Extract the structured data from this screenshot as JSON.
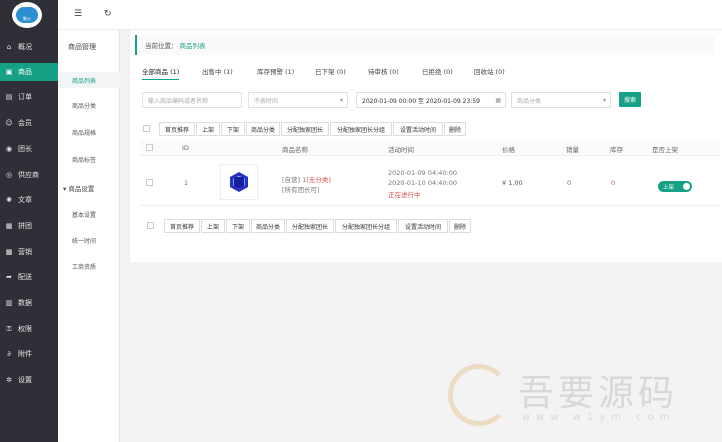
{
  "brand": {
    "logo_text": "聚火"
  },
  "sidebar": {
    "items": [
      {
        "label": "概况",
        "icon": "home-icon"
      },
      {
        "label": "商品",
        "icon": "grid-icon"
      },
      {
        "label": "订单",
        "icon": "document-icon"
      },
      {
        "label": "会员",
        "icon": "user-icon"
      },
      {
        "label": "团长",
        "icon": "team-icon"
      },
      {
        "label": "供应商",
        "icon": "supplier-icon"
      },
      {
        "label": "文章",
        "icon": "compass-icon"
      },
      {
        "label": "拼团",
        "icon": "group-icon"
      },
      {
        "label": "营销",
        "icon": "marketing-icon"
      },
      {
        "label": "配送",
        "icon": "delivery-icon"
      },
      {
        "label": "数据",
        "icon": "chart-icon"
      },
      {
        "label": "权限",
        "icon": "lock-icon"
      },
      {
        "label": "附件",
        "icon": "attachment-icon"
      },
      {
        "label": "设置",
        "icon": "gear-icon"
      }
    ],
    "active_index": 1
  },
  "subnav": {
    "title": "商品管理",
    "items": [
      "商品列表",
      "商品分类",
      "商品规格",
      "商品标签"
    ],
    "group": "商品设置",
    "group_items": [
      "基本设置",
      "统一时间",
      "工商资质"
    ],
    "active_index": 0
  },
  "breadcrumb": {
    "prefix": "当前位置：",
    "current": "商品列表"
  },
  "tabs": [
    {
      "label": "全部商品",
      "count": "(1)"
    },
    {
      "label": "出售中",
      "count": "(1)"
    },
    {
      "label": "库存预警",
      "count": "(1)"
    },
    {
      "label": "已下架",
      "count": "(0)"
    },
    {
      "label": "待审核",
      "count": "(0)"
    },
    {
      "label": "已拒绝",
      "count": "(0)"
    },
    {
      "label": "回收站",
      "count": "(0)"
    }
  ],
  "filters": {
    "keyword_placeholder": "输入商品编码或者名称",
    "time_select": "不按时间",
    "date_range": "2020-01-09 00:00 至 2020-01-09 23:59",
    "category_placeholder": "商品分类",
    "search_label": "搜索"
  },
  "bulk_actions": [
    "首页推荐",
    "上架",
    "下架",
    "商品分类",
    "分配独家团长",
    "分配独家团长分组",
    "设置活动时间",
    "删除"
  ],
  "table": {
    "headers": [
      "ID",
      "商品名称",
      "活动时间",
      "价格",
      "销量",
      "库存",
      "是否上架"
    ],
    "rows": [
      {
        "id": "1",
        "name_line1_prefix": "[自营] 1",
        "name_line1_tag": "[无分类]",
        "name_line2": "[所有团长可]",
        "time_start": "2020-01-09 04:40:00",
        "time_end": "2020-01-10 04:40:00",
        "time_status": "正在进行中",
        "price": "¥ 1.00",
        "sales": "0",
        "stock": "0",
        "toggle_label": "上架",
        "on_sale": true
      }
    ]
  },
  "watermark": {
    "text": "吾要源码",
    "url": "www.w1ym.com"
  },
  "colors": {
    "accent": "#16a085",
    "sidebar": "#2f3037",
    "danger": "#d9534f"
  }
}
